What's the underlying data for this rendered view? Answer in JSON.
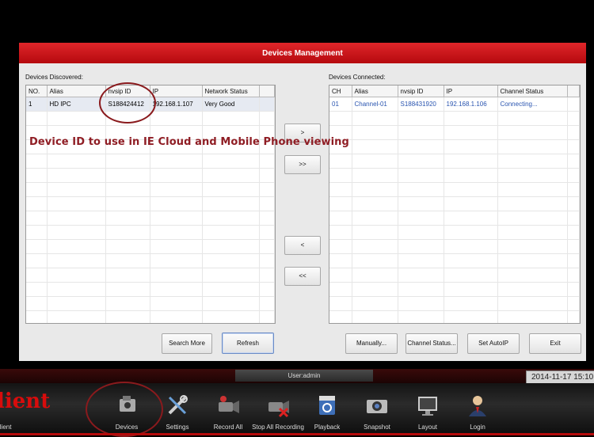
{
  "dialog": {
    "title": "Devices Management",
    "discovered_label": "Devices Discovered:",
    "connected_label": "Devices Connected:",
    "discovered": {
      "headers": [
        "NO.",
        "Alias",
        "nvsip ID",
        "IP",
        "Network Status"
      ],
      "rows": [
        [
          "1",
          "HD IPC",
          "S188424412",
          "192.168.1.107",
          "Very Good"
        ]
      ]
    },
    "connected": {
      "headers": [
        "CH",
        "Alias",
        "nvsip ID",
        "IP",
        "Channel Status"
      ],
      "rows": [
        [
          "01",
          "Channel-01",
          "S188431920",
          "192.168.1.106",
          "Connecting..."
        ]
      ]
    },
    "buttons": {
      "add_one": ">",
      "add_all": ">>",
      "remove_one": "<",
      "remove_all": "<<",
      "search_more": "Search More",
      "refresh": "Refresh",
      "manually": "Manually...",
      "channel_status": "Channel Status...",
      "set_autoip": "Set AutoIP",
      "exit": "Exit"
    }
  },
  "annotation": "Device ID to use in IE Cloud and Mobile Phone viewing",
  "status": {
    "user": "User:admin",
    "datetime": "2014-11-17 15:10:"
  },
  "toolbar": {
    "brand": "lient",
    "brand_small": "Client",
    "items": [
      "Devices",
      "Settings",
      "Record All",
      "Stop All Recording",
      "Playback",
      "Snapshot",
      "Layout",
      "Login"
    ]
  },
  "colors": {
    "title_red": "#c8141a",
    "annotation": "#8f1d24",
    "connected_text": "#2a55b0"
  }
}
